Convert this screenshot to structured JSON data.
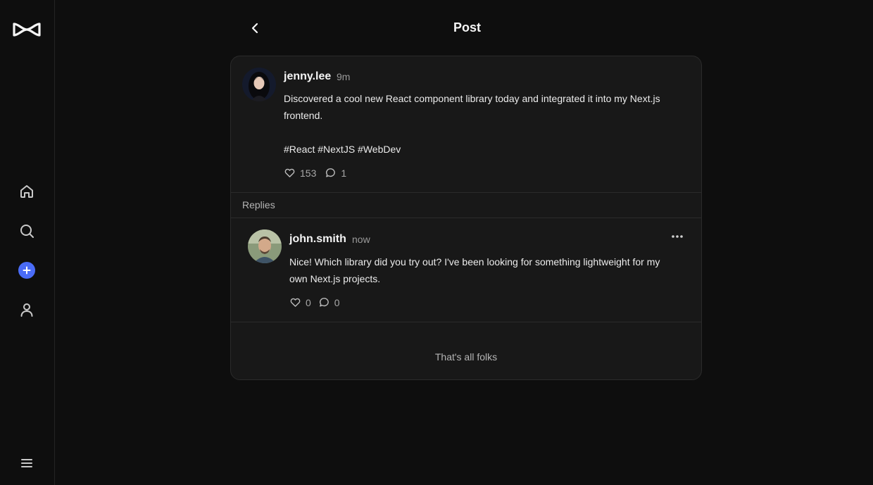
{
  "app": {
    "logo_icon": "infinity-logo-icon",
    "accent_color": "#4a6cf7"
  },
  "sidebar": {
    "items": [
      {
        "icon": "home-icon"
      },
      {
        "icon": "search-icon"
      },
      {
        "icon": "plus-icon"
      },
      {
        "icon": "user-icon"
      }
    ],
    "menu_icon": "menu-icon"
  },
  "header": {
    "back_icon": "chevron-left-icon",
    "title": "Post"
  },
  "post": {
    "username": "jenny.lee",
    "time": "9m",
    "text": "Discovered a cool new React component library today and integrated it into my Next.js\nfrontend.\n\n#React #NextJS #WebDev",
    "likes": "153",
    "comments": "1"
  },
  "replies": {
    "label": "Replies",
    "items": [
      {
        "username": "john.smith",
        "time": "now",
        "text": "Nice! Which library did you try out? I've been looking for something lightweight for my\nown Next.js projects.",
        "likes": "0",
        "comments": "0"
      }
    ],
    "end_text": "That's all folks"
  }
}
